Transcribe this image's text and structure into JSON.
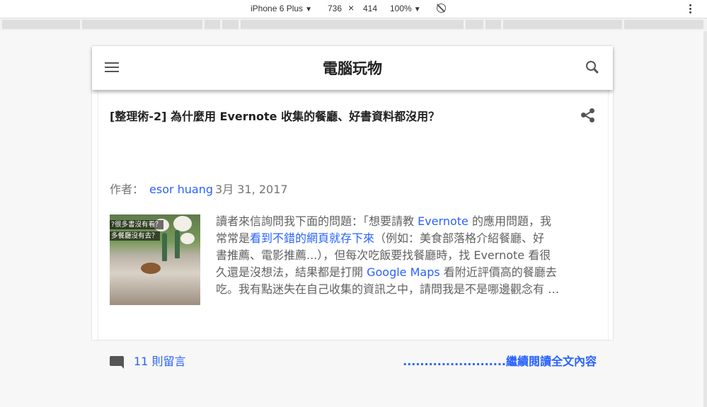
{
  "device_toolbar": {
    "device": "iPhone 6 Plus",
    "width": "736",
    "times": "×",
    "height": "414",
    "zoom": "100%",
    "caret": "▼"
  },
  "blog": {
    "title": "電腦玩物"
  },
  "post": {
    "title": "[整理術-2] 為什麼用 Evernote 收集的餐廳、好書資料都沒用？",
    "byline_prefix": "作者：",
    "author": "esor huang",
    "date": "3月 31, 2017",
    "thumbnail_caption_1": "?很多書沒有看？",
    "thumbnail_caption_2": "多餐廳沒有去？",
    "excerpt": {
      "l1_a": "讀者來信詢問我下面的問題：「想要請教 ",
      "l1_link": "Evernote",
      "l1_b": " 的應用問題，我",
      "l2_a": "常常是",
      "l2_link": "看到不錯的網頁就存下來",
      "l2_b": "（例如：美食部落格介紹餐廳、好",
      "l3": "書推薦、電影推薦...），但每次吃飯要找餐廳時，找 Evernote 看很",
      "l4_a": "久還是沒想法，結果都是打開 ",
      "l4_link": "Google Maps",
      "l4_b": " 看附近評價高的餐廳去",
      "l5": "吃。我有點迷失在自己收集的資訊之中，請問我是不是哪邊觀念有 …"
    },
    "comments": "11 則留言",
    "read_more": "........................繼續閱讀全文內容"
  },
  "colors": {
    "link": "#2962ff",
    "muted": "#757575",
    "icon": "#555555"
  },
  "icons": [
    "menu-icon",
    "search-icon",
    "share-icon",
    "comment-icon",
    "rotate-icon",
    "kebab-icon"
  ]
}
